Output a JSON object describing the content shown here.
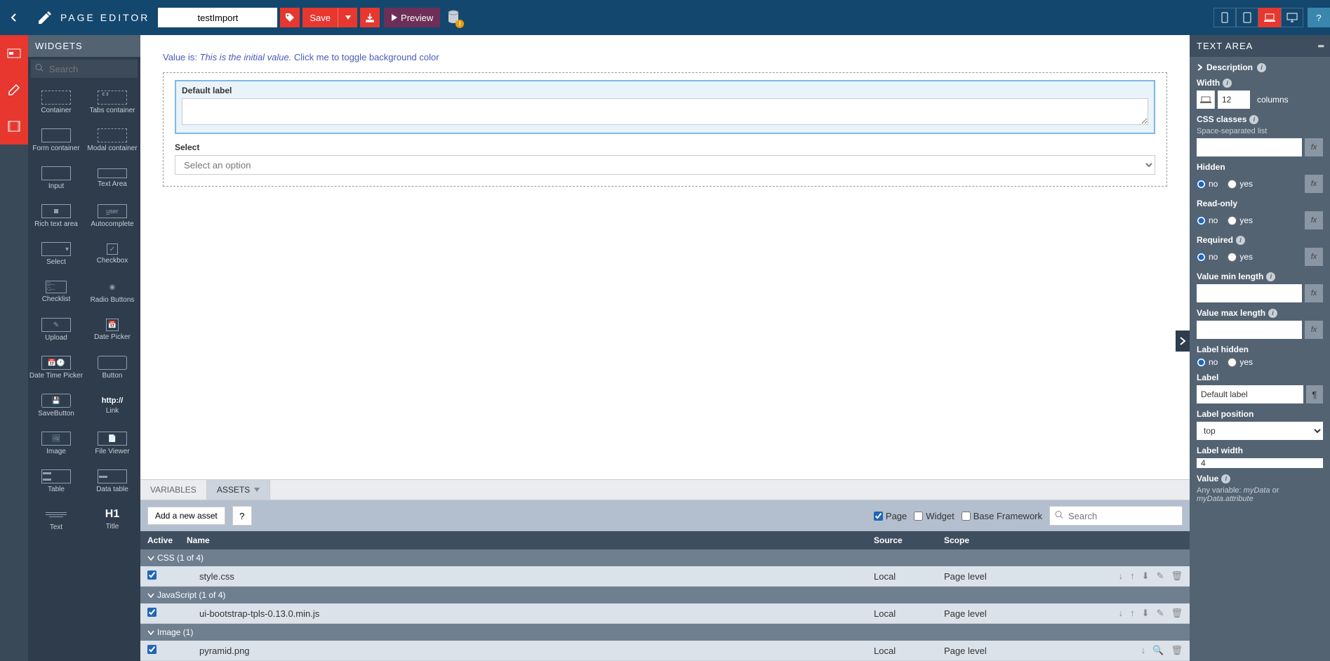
{
  "header": {
    "title": "PAGE EDITOR",
    "pageName": "testImport",
    "save": "Save",
    "preview": "Preview"
  },
  "palette": {
    "title": "WIDGETS",
    "searchPlaceholder": "Search",
    "items": [
      [
        "Container",
        "Tabs container"
      ],
      [
        "Form container",
        "Modal container"
      ],
      [
        "Input",
        "Text Area"
      ],
      [
        "Rich text area",
        "Autocomplete"
      ],
      [
        "Select",
        "Checkbox"
      ],
      [
        "Checklist",
        "Radio Buttons"
      ],
      [
        "Upload",
        "Date Picker"
      ],
      [
        "Date Time Picker",
        "Button"
      ],
      [
        "SaveButton",
        "Link"
      ],
      [
        "Image",
        "File Viewer"
      ],
      [
        "Table",
        "Data table"
      ],
      [
        "Text",
        "Title"
      ]
    ]
  },
  "canvas": {
    "valueLinePre": "Value is: ",
    "valueLineItalic": "This is the initial value.",
    "valueLinePost": " Click me to toggle background color",
    "textAreaLabel": "Default label",
    "selectLabel": "Select",
    "selectPlaceholder": "Select an option"
  },
  "bottom": {
    "tabs": {
      "variables": "VARIABLES",
      "assets": "ASSETS"
    },
    "addAsset": "Add a new asset",
    "filters": {
      "page": "Page",
      "widget": "Widget",
      "baseFramework": "Base Framework"
    },
    "searchPlaceholder": "Search",
    "cols": {
      "active": "Active",
      "name": "Name",
      "source": "Source",
      "scope": "Scope"
    },
    "groups": {
      "css": "CSS (1 of 4)",
      "js": "JavaScript (1 of 4)",
      "img": "Image (1)"
    },
    "rows": [
      {
        "name": "style.css",
        "source": "Local",
        "scope": "Page level",
        "active": true
      },
      {
        "name": "ui-bootstrap-tpls-0.13.0.min.js",
        "source": "Local",
        "scope": "Page level",
        "active": true
      },
      {
        "name": "pyramid.png",
        "source": "Local",
        "scope": "Page level",
        "active": true
      }
    ]
  },
  "right": {
    "title": "TEXT AREA",
    "description": "Description",
    "width": {
      "label": "Width",
      "value": "12",
      "columns": "columns"
    },
    "cssClasses": {
      "label": "CSS classes",
      "sub": "Space-separated list",
      "value": ""
    },
    "hidden": {
      "label": "Hidden",
      "no": "no",
      "yes": "yes"
    },
    "readonly": {
      "label": "Read-only",
      "no": "no",
      "yes": "yes"
    },
    "required": {
      "label": "Required",
      "no": "no",
      "yes": "yes"
    },
    "minLen": {
      "label": "Value min length",
      "value": ""
    },
    "maxLen": {
      "label": "Value max length",
      "value": ""
    },
    "labelHidden": {
      "label": "Label hidden",
      "no": "no",
      "yes": "yes"
    },
    "labelProp": {
      "label": "Label",
      "value": "Default label"
    },
    "labelPos": {
      "label": "Label position",
      "value": "top"
    },
    "labelWidth": {
      "label": "Label width",
      "value": "4"
    },
    "value": {
      "label": "Value",
      "sub": "Any variable: myData or myData.attribute"
    },
    "anyVarPre": "Any variable: ",
    "anyVar1": "myData",
    "anyOr": " or ",
    "anyVar2": "myData.attribute"
  }
}
